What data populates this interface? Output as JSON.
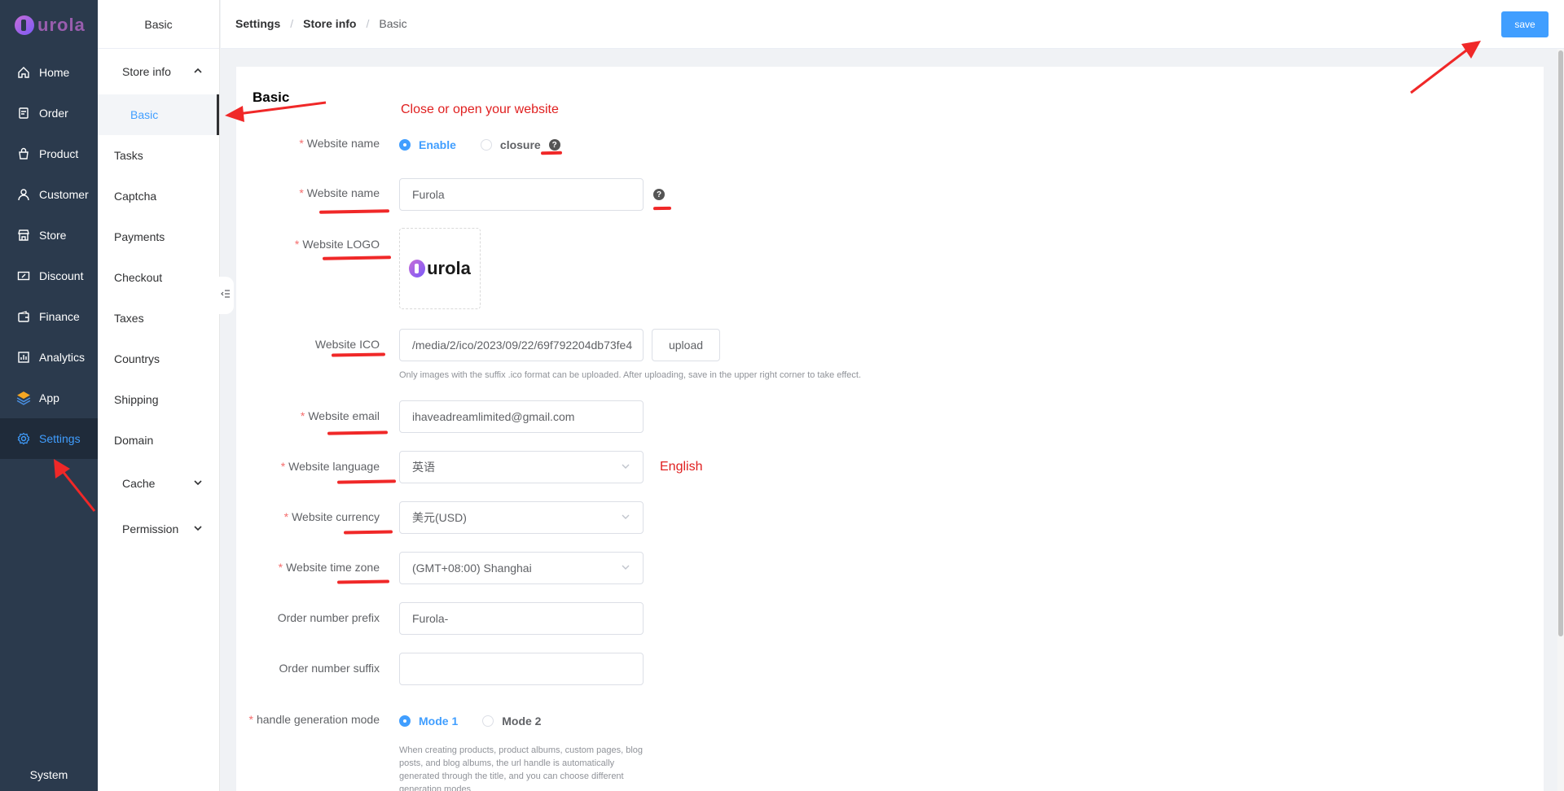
{
  "sidebar": {
    "logo_text": "urola",
    "items": [
      {
        "label": "Home",
        "icon": "home-icon"
      },
      {
        "label": "Order",
        "icon": "order-icon"
      },
      {
        "label": "Product",
        "icon": "product-icon"
      },
      {
        "label": "Customer",
        "icon": "customer-icon"
      },
      {
        "label": "Store",
        "icon": "store-icon"
      },
      {
        "label": "Discount",
        "icon": "discount-icon"
      },
      {
        "label": "Finance",
        "icon": "finance-icon"
      },
      {
        "label": "Analytics",
        "icon": "analytics-icon"
      },
      {
        "label": "App",
        "icon": "app-icon"
      },
      {
        "label": "Settings",
        "icon": "gear-icon"
      }
    ],
    "active": "Settings",
    "footer": "System"
  },
  "subbar": {
    "title": "Basic",
    "group_store_info": "Store info",
    "active_child": "Basic",
    "items": [
      "Tasks",
      "Captcha",
      "Payments",
      "Checkout",
      "Taxes",
      "Countrys",
      "Shipping",
      "Domain"
    ],
    "group_cache": "Cache",
    "group_permission": "Permission"
  },
  "breadcrumb": {
    "level1": "Settings",
    "level2": "Store info",
    "level3": "Basic"
  },
  "toolbar": {
    "save_label": "save"
  },
  "form": {
    "title": "Basic",
    "website_status": {
      "label": "Website name",
      "options": [
        "Enable",
        "closure"
      ],
      "selected": "Enable"
    },
    "website_name": {
      "label": "Website name",
      "value": "Furola"
    },
    "website_logo": {
      "label": "Website LOGO",
      "logo_text": "urola"
    },
    "website_ico": {
      "label": "Website ICO",
      "value": "/media/2/ico/2023/09/22/69f792204db73fe4",
      "upload_label": "upload",
      "hint": "Only images with the suffix .ico format can be uploaded. After uploading, save in the upper right corner to take effect."
    },
    "website_email": {
      "label": "Website email",
      "value": "ihaveadreamlimited@gmail.com"
    },
    "website_language": {
      "label": "Website language",
      "value": "英语"
    },
    "website_currency": {
      "label": "Website currency",
      "value": "美元(USD)"
    },
    "website_timezone": {
      "label": "Website time zone",
      "value": "(GMT+08:00) Shanghai"
    },
    "order_prefix": {
      "label": "Order number prefix",
      "value": "Furola-"
    },
    "order_suffix": {
      "label": "Order number suffix",
      "value": ""
    },
    "handle_mode": {
      "label": "handle generation mode",
      "options": [
        "Mode 1",
        "Mode 2"
      ],
      "selected": "Mode 1",
      "hint": "When creating products, product albums, custom pages, blog posts, and blog albums, the url handle is automatically generated through the title, and you can choose different generation modes"
    }
  },
  "annotations": {
    "note_status": "Close or open your website",
    "note_language": "English"
  },
  "colors": {
    "primary": "#409eff",
    "sidebar": "#2b3a4d",
    "annotation": "#e02020"
  }
}
